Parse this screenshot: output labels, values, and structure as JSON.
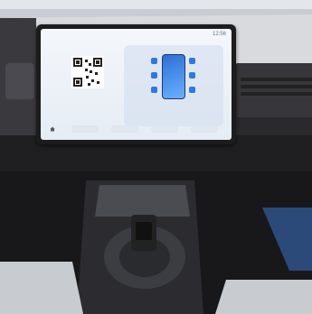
{
  "screen": {
    "clock": "12:56",
    "qr_caption": "",
    "qr_status": "",
    "tabs": [
      "",
      "",
      "",
      ""
    ]
  },
  "colors": {
    "accent": "#2f78e0",
    "display_bg": "#eef2f8",
    "interior": "#2a2a2c"
  },
  "icons": [
    "home-icon",
    "qr-code",
    "phone-icon"
  ]
}
